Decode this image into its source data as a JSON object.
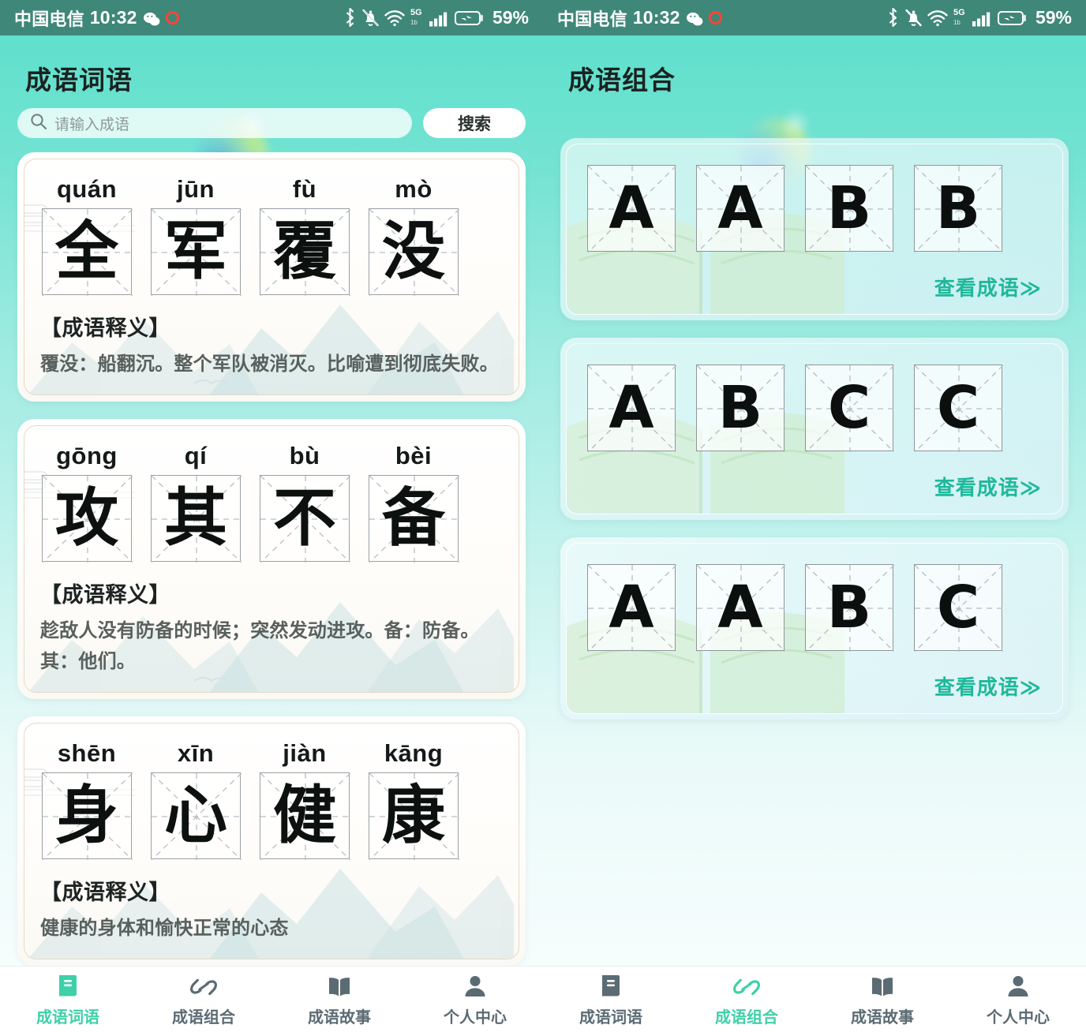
{
  "theme": {
    "accent": "#3ed0a8",
    "link": "#1fb89a",
    "statusbar_bg": "#3f8779",
    "tab_inactive": "#5b6b73",
    "card_border": "#e6d9c6",
    "grid_border": "#9aa0a4"
  },
  "statusbar": {
    "carrier": "中国电信",
    "time": "10:32",
    "battery": "59%",
    "network_label": "5G",
    "network_sub": "1b",
    "icons": [
      "wechat-icon",
      "record-icon",
      "bluetooth-icon",
      "mute-bell-icon",
      "wifi-icon",
      "signal-icon",
      "battery-icon"
    ]
  },
  "left": {
    "title": "成语词语",
    "search": {
      "placeholder": "请输入成语",
      "value": "",
      "button_label": "搜索",
      "icon": "search-icon"
    },
    "meaning_heading": "【成语释义】",
    "cards": [
      {
        "pinyin": [
          "quán",
          "jūn",
          "fù",
          "mò"
        ],
        "chars": [
          "全",
          "军",
          "覆",
          "没"
        ],
        "meaning": "覆没：船翻沉。整个军队被消灭。比喻遭到彻底失败。"
      },
      {
        "pinyin": [
          "gōng",
          "qí",
          "bù",
          "bèi"
        ],
        "chars": [
          "攻",
          "其",
          "不",
          "备"
        ],
        "meaning": "趁敌人没有防备的时候；突然发动进攻。备：防备。其：他们。"
      },
      {
        "pinyin": [
          "shēn",
          "xīn",
          "jiàn",
          "kāng"
        ],
        "chars": [
          "身",
          "心",
          "健",
          "康"
        ],
        "meaning": "健康的身体和愉快正常的心态"
      }
    ],
    "tabs": [
      {
        "label": "成语词语",
        "icon": "book-closed-icon",
        "active": true
      },
      {
        "label": "成语组合",
        "icon": "link-chain-icon",
        "active": false
      },
      {
        "label": "成语故事",
        "icon": "book-open-icon",
        "active": false
      },
      {
        "label": "个人中心",
        "icon": "person-icon",
        "active": false
      }
    ]
  },
  "right": {
    "title": "成语组合",
    "view_link_label": "查看成语",
    "view_link_icon": "double-chevron-right-icon",
    "cards": [
      {
        "letters": [
          "A",
          "A",
          "B",
          "B"
        ]
      },
      {
        "letters": [
          "A",
          "B",
          "C",
          "C"
        ]
      },
      {
        "letters": [
          "A",
          "A",
          "B",
          "C"
        ]
      }
    ],
    "tabs": [
      {
        "label": "成语词语",
        "icon": "book-closed-icon",
        "active": false
      },
      {
        "label": "成语组合",
        "icon": "link-chain-icon",
        "active": true
      },
      {
        "label": "成语故事",
        "icon": "book-open-icon",
        "active": false
      },
      {
        "label": "个人中心",
        "icon": "person-icon",
        "active": false
      }
    ]
  }
}
